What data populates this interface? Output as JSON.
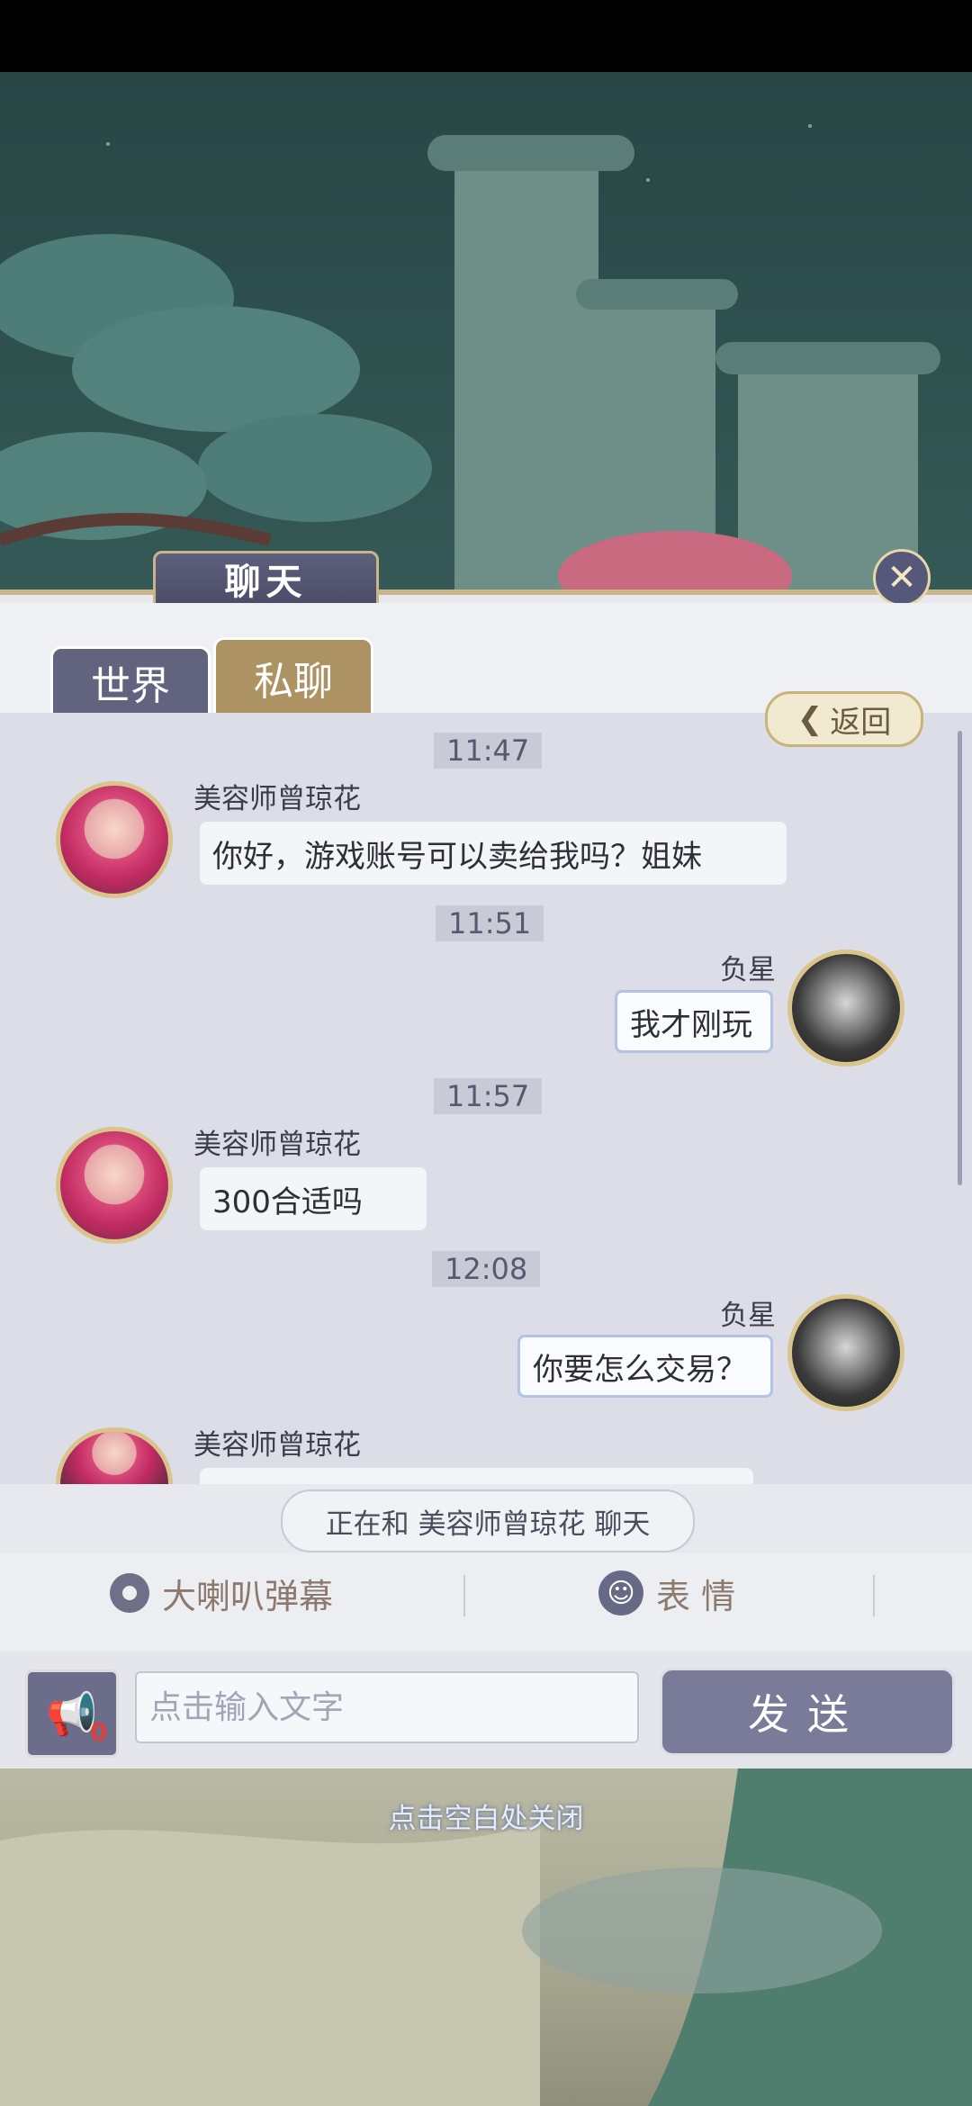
{
  "panel": {
    "title": "聊天",
    "tabs": [
      {
        "label": "世界"
      },
      {
        "label": "私聊"
      }
    ],
    "back_label": "返回"
  },
  "messages": [
    {
      "time": "11:47",
      "sender": "美容师曾琼花",
      "text": "你好，游戏账号可以卖给我吗？姐妹",
      "side": "left"
    },
    {
      "time": "11:51",
      "sender": "负星",
      "text": "我才刚玩",
      "side": "right"
    },
    {
      "time": "11:57",
      "sender": "美容师曾琼花",
      "text": "300合适吗",
      "side": "left"
    },
    {
      "time": "12:08",
      "sender": "负星",
      "text": "你要怎么交易？",
      "side": "right"
    },
    {
      "sender": "美容师曾琼花",
      "text": "",
      "side": "left"
    }
  ],
  "status": {
    "chatting_with": "正在和 美容师曾琼花 聊天"
  },
  "toolbar": {
    "broadcast_label": "大喇叭弹幕",
    "emoji_label": "表 情"
  },
  "input": {
    "placeholder": "点击输入文字",
    "horn_count": "0",
    "send_label": "发送"
  },
  "hint": "点击空白处关闭"
}
